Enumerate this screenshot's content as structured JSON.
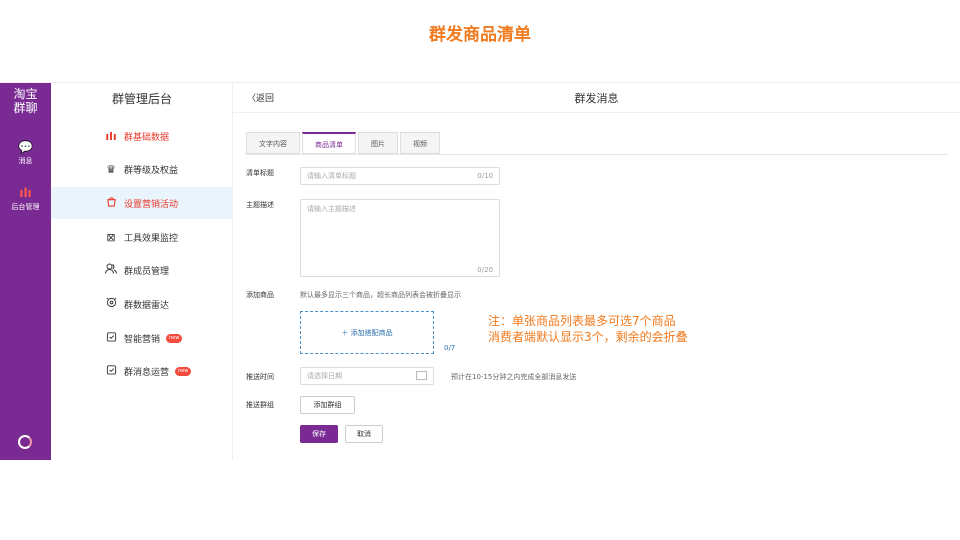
{
  "slide": {
    "title": "群发商品清单"
  },
  "rail": {
    "brand_line1": "淘宝",
    "brand_line2": "群聊",
    "items": [
      {
        "label": "消息",
        "icon": "chat-bubble-icon"
      },
      {
        "label": "后台管理",
        "icon": "bar-chart-icon"
      }
    ]
  },
  "sidebar": {
    "title": "群管理后台",
    "items": [
      {
        "label": "群基础数据",
        "icon": "bar-chart-icon"
      },
      {
        "label": "群等级及权益",
        "icon": "crown-icon"
      },
      {
        "label": "设置营销活动",
        "icon": "shopping-bag-icon"
      },
      {
        "label": "工具效果监控",
        "icon": "monitor-icon"
      },
      {
        "label": "群成员管理",
        "icon": "people-icon"
      },
      {
        "label": "群数据雷达",
        "icon": "radar-icon"
      },
      {
        "label": "智能营销",
        "icon": "clipboard-icon",
        "badge": "new"
      },
      {
        "label": "群消息运营",
        "icon": "clipboard-icon",
        "badge": "new"
      }
    ]
  },
  "main": {
    "back_label": "〈返回",
    "page_title": "群发消息",
    "tabs": [
      "文字内容",
      "商品清单",
      "图片",
      "视频"
    ],
    "form": {
      "list_title_label": "清单标题",
      "list_title_placeholder": "请输入清单标题",
      "list_title_counter": "0/10",
      "topic_label": "主题描述",
      "topic_placeholder": "请输入主题描述",
      "topic_counter": "0/20",
      "add_product_label": "添加商品",
      "add_product_hint": "默认最多显示三个商品，超长商品列表会被折叠显示",
      "add_product_button": "＋ 添加搭配商品",
      "add_product_counter": "0/7",
      "push_time_label": "推送时间",
      "push_time_placeholder": "请选择日期",
      "push_time_hint": "预计在10-15分钟之内完成全部消息发送",
      "push_group_label": "推送群组",
      "add_group_button": "添加群组",
      "save_button": "保存",
      "cancel_button": "取消"
    }
  },
  "note": {
    "line1": "注：单张商品列表最多可选7个商品",
    "line2": "消费者端默认显示3个，剩余的会折叠"
  },
  "colors": {
    "accent": "#7a2a93",
    "note": "#f07a1e",
    "alert": "#e8392c"
  }
}
